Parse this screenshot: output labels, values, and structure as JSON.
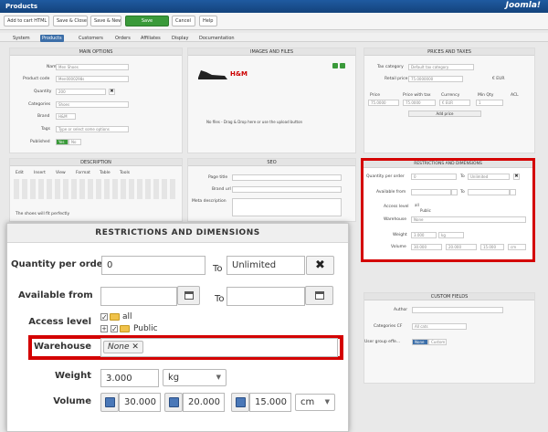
{
  "app": {
    "title": "Products",
    "logo": "Joomla!"
  },
  "toolbar": {
    "add_to_cart": "Add to cart HTML link",
    "save_close": "Save & Close",
    "save_new": "Save & New",
    "save": "Save",
    "cancel": "Cancel",
    "help": "Help"
  },
  "menu": [
    "System",
    "Products",
    "Customers",
    "Orders",
    "Affiliates",
    "Display",
    "Documentation"
  ],
  "main_options": {
    "heading": "MAIN OPTIONS",
    "name_label": "Name",
    "name_value": "Men Shoes",
    "code_label": "Product code",
    "code_value": "Men0000298s",
    "qty_label": "Quantity",
    "qty_value": "200",
    "cat_label": "Categories",
    "cat_value": "Shoes",
    "brand_label": "Brand",
    "brand_value": "H&M",
    "tags_label": "Tags",
    "tags_placeholder": "Type or select some options",
    "pub_label": "Published",
    "pub_yes": "Yes",
    "pub_no": "No"
  },
  "images": {
    "heading": "IMAGES AND FILES",
    "drop_text": "No files - Drag & Drop here or use the upload button",
    "brand_logo": "H&M"
  },
  "prices": {
    "heading": "PRICES AND TAXES",
    "tax_label": "Tax category",
    "tax_value": "Default tax category",
    "retail_label": "Retail price",
    "retail_value": "75.0000000",
    "retail_currency": "€ EUR",
    "cols": [
      "Price",
      "Price with tax",
      "Currency",
      "Min Qty",
      "ACL"
    ],
    "price_value": "75.0000",
    "pwt_value": "75.0000",
    "cur_value": "€ EUR",
    "minqty_value": "1",
    "add_price": "Add price"
  },
  "description": {
    "heading": "DESCRIPTION",
    "menus": [
      "Edit",
      "Insert",
      "View",
      "Format",
      "Table",
      "Tools"
    ],
    "body": "The shoes will fit perfectly"
  },
  "seo": {
    "heading": "SEO",
    "page_title": "Page title",
    "brand_url": "Brand url",
    "meta_desc": "Meta description"
  },
  "custom_fields": {
    "heading": "CUSTOM FIELDS",
    "author": "Author",
    "categories": "Categories CF",
    "categories_value": "All cats",
    "user_group": "User group effe...",
    "none": "None",
    "custom": "Custom"
  },
  "restrictions": {
    "heading": "RESTRICTIONS AND DIMENSIONS",
    "qty_label": "Quantity per order",
    "qty_min": "0",
    "to": "To",
    "qty_max": "Unlimited",
    "clear": "✖",
    "avail_label": "Available from",
    "access_label": "Access level",
    "access_all": "all",
    "access_public": "Public",
    "warehouse_label": "Warehouse",
    "warehouse_tag": "None",
    "weight_label": "Weight",
    "weight_value": "3.000",
    "weight_unit": "kg",
    "volume_label": "Volume",
    "vol_1": "30.000",
    "vol_2": "20.000",
    "vol_3": "15.000",
    "vol_unit": "cm"
  }
}
